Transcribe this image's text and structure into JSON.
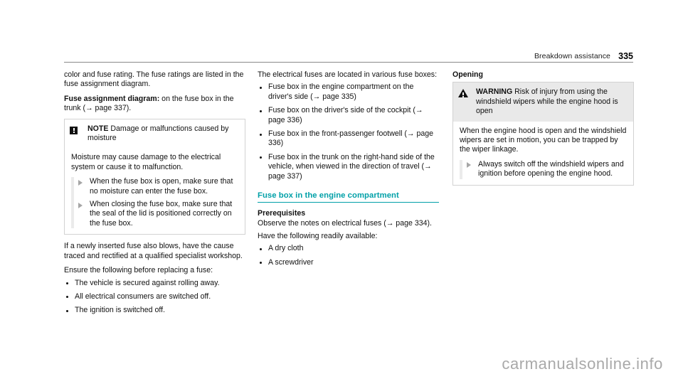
{
  "header": {
    "section_title": "Breakdown assistance",
    "page_number": "335"
  },
  "colors": {
    "accent_teal": "#00a0a8",
    "note_header_bg": "#ffffff",
    "warning_header_bg": "#e9e9e9",
    "box_border": "#d2d2d2",
    "bullet_triangle": "#a6a6a6",
    "watermark": "#a9a9a9"
  },
  "column_left": {
    "intro_para": "color and fuse rating. The fuse ratings are listed in the fuse assignment diagram.",
    "diagram_label": "Fuse assignment diagram:",
    "diagram_text": " on the fuse box in the trunk (→ page 337).",
    "note_box": {
      "icon": "note-icon",
      "label": "NOTE",
      "title": " Damage or malfunctions caused by moisture",
      "body_para": "Moisture may cause damage to the electrical system or cause it to malfunction.",
      "actions": [
        "When the fuse box is open, make sure that no moisture can enter the fuse box.",
        "When closing the fuse box, make sure that the seal of the lid is positioned correctly on the fuse box."
      ]
    },
    "after_note_para": "If a newly inserted fuse also blows, have the cause traced and rectified at a qualified specialist workshop.",
    "ensure_lead": "Ensure the following before replacing a fuse:",
    "ensure_items": [
      "The vehicle is secured against rolling away.",
      "All electrical consumers are switched off.",
      "The ignition is switched off."
    ]
  },
  "column_middle": {
    "lead_para": "The electrical fuses are located in various fuse boxes:",
    "fuse_box_items": [
      "Fuse box in the engine compartment on the driver's side (→ page 335)",
      "Fuse box on the driver's side of the cockpit (→ page 336)",
      "Fuse box in the front-passenger footwell (→ page 336)",
      "Fuse box in the trunk on the right-hand side of the vehicle, when viewed in the direction of travel (→ page 337)"
    ],
    "section_heading": "Fuse box in the engine compartment",
    "prerequisites_heading": "Prerequisites",
    "prerequisites_para": "Observe the notes on electrical fuses (→ page 334).",
    "available_lead": "Have the following readily available:",
    "available_items": [
      "A dry cloth",
      "A screwdriver"
    ]
  },
  "column_right": {
    "heading": "Opening",
    "warning_box": {
      "icon": "warning-triangle-icon",
      "label": "WARNING",
      "title": " Risk of injury from using the windshield wipers while the engine hood is open",
      "body_para": "When the engine hood is open and the windshield wipers are set in motion, you can be trapped by the wiper linkage.",
      "actions": [
        "Always switch off the windshield wipers and ignition before opening the engine hood."
      ]
    }
  },
  "watermark": {
    "text": "carmanualsonline.info"
  }
}
